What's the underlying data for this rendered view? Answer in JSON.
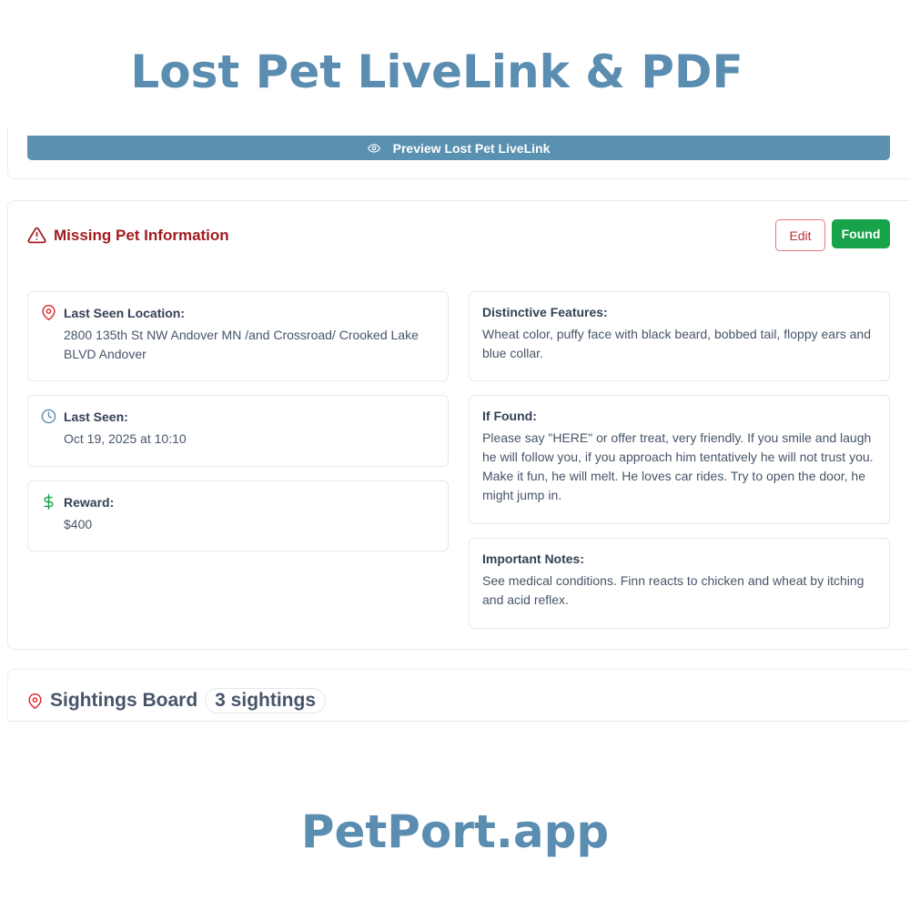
{
  "headline": "Lost Pet LiveLink & PDF",
  "preview_button": {
    "label": "Preview Lost Pet LiveLink",
    "icon": "eye-icon"
  },
  "missing_card": {
    "title": "Missing Pet Information",
    "title_color": "#a11d21",
    "edit_label": "Edit",
    "found_label": "Found",
    "found_color": "#16a34a"
  },
  "last_seen_location": {
    "label": "Last Seen Location:",
    "value": "2800 135th St NW Andover MN /and Crossroad/ Crooked Lake BLVD Andover",
    "icon": "map-pin-icon"
  },
  "last_seen": {
    "label": "Last Seen:",
    "value": "Oct 19, 2025 at 10:10",
    "icon": "clock-icon"
  },
  "reward": {
    "label": "Reward:",
    "value": "$400",
    "icon": "dollar-icon"
  },
  "distinctive_features": {
    "label": "Distinctive Features:",
    "value": "Wheat color, puffy face with black beard, bobbed tail, floppy ears and blue collar."
  },
  "if_found": {
    "label": "If Found:",
    "value": "Please say \"HERE\" or offer treat, very friendly. If you smile and laugh he will follow you, if you approach him tentatively he will not trust you. Make it fun, he will melt. He loves car rides. Try to open the door, he might jump in."
  },
  "important_notes": {
    "label": "Important Notes:",
    "value": "See medical conditions. Finn reacts to chicken and wheat by itching and acid reflex."
  },
  "sightings": {
    "title": "Sightings Board",
    "count_label": "3 sightings"
  },
  "brand": "PetPort.app",
  "brand_color": "#5a8db0"
}
